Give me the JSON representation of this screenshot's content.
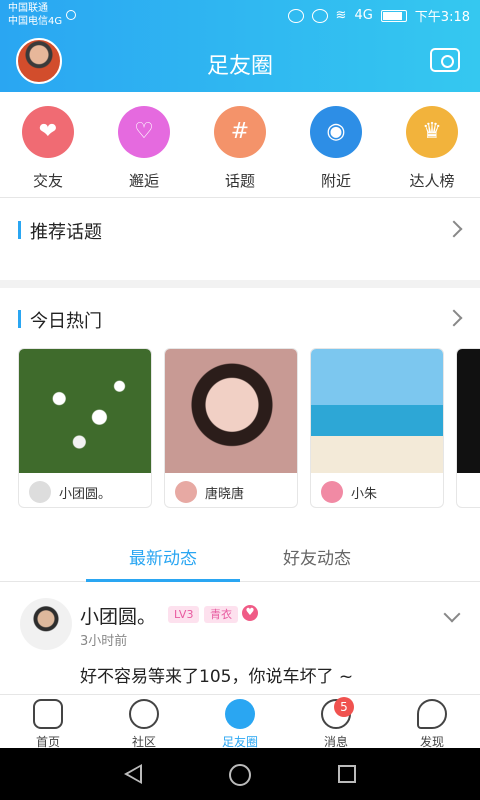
{
  "status": {
    "carrier1": "中国联通",
    "carrier2": "中国电信4G",
    "time": "下午3:18",
    "signal": "4G"
  },
  "header": {
    "title": "足友圈",
    "avatar_icon": "avatar",
    "camera_icon": "camera-icon"
  },
  "quick": [
    {
      "label": "交友",
      "icon": "heart-chat-icon",
      "color": "#f06b73"
    },
    {
      "label": "邂逅",
      "icon": "heartbeat-icon",
      "color": "#e56adf"
    },
    {
      "label": "话题",
      "icon": "hashtag-icon",
      "color": "#f4936a"
    },
    {
      "label": "附近",
      "icon": "location-icon",
      "color": "#2d8ee6"
    },
    {
      "label": "达人榜",
      "icon": "crown-icon",
      "color": "#f2b33c"
    }
  ],
  "sections": {
    "topics": "推荐话题",
    "hot": "今日热门"
  },
  "hot_cards": [
    {
      "name": "小团圆。",
      "image": "white-flowers"
    },
    {
      "name": "唐晓唐",
      "image": "girl-portrait"
    },
    {
      "name": "小朱",
      "image": "flamingos-beach"
    }
  ],
  "tabs": {
    "latest": "最新动态",
    "friends": "好友动态"
  },
  "post": {
    "name": "小团圆。",
    "badge1": "LV3",
    "badge2": "青衣",
    "time": "3小时前",
    "text": "好不容易等来了105，你说车坏了 ~"
  },
  "nav": [
    {
      "label": "首页",
      "icon": "home-icon"
    },
    {
      "label": "社区",
      "icon": "community-icon"
    },
    {
      "label": "足友圈",
      "icon": "circle-eye-icon"
    },
    {
      "label": "消息",
      "icon": "message-icon",
      "badge": "5"
    },
    {
      "label": "发现",
      "icon": "rocket-icon"
    }
  ],
  "colors": {
    "accent": "#2aa6f2"
  }
}
